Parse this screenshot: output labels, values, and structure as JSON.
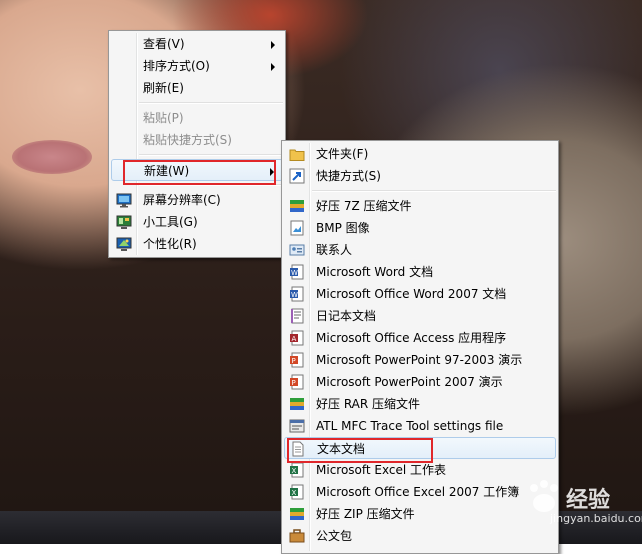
{
  "context_menu": {
    "items": [
      {
        "label": "查看(V)"
      },
      {
        "label": "排序方式(O)"
      },
      {
        "label": "刷新(E)"
      },
      {
        "label": "粘贴(P)"
      },
      {
        "label": "粘贴快捷方式(S)"
      },
      {
        "label": "新建(W)"
      },
      {
        "label": "屏幕分辨率(C)"
      },
      {
        "label": "小工具(G)"
      },
      {
        "label": "个性化(R)"
      }
    ]
  },
  "new_submenu": {
    "items": [
      {
        "label": "文件夹(F)",
        "icon": "folder-icon"
      },
      {
        "label": "快捷方式(S)",
        "icon": "shortcut-icon"
      },
      {
        "label": "好压 7Z 压缩文件",
        "icon": "archive-icon"
      },
      {
        "label": "BMP 图像",
        "icon": "image-icon"
      },
      {
        "label": "联系人",
        "icon": "contact-icon"
      },
      {
        "label": "Microsoft Word 文档",
        "icon": "word-icon"
      },
      {
        "label": "Microsoft Office Word 2007 文档",
        "icon": "word-icon"
      },
      {
        "label": "日记本文档",
        "icon": "journal-icon"
      },
      {
        "label": "Microsoft Office Access 应用程序",
        "icon": "access-icon"
      },
      {
        "label": "Microsoft PowerPoint 97-2003 演示",
        "icon": "powerpoint-icon"
      },
      {
        "label": "Microsoft PowerPoint 2007 演示",
        "icon": "powerpoint-icon"
      },
      {
        "label": "好压 RAR 压缩文件",
        "icon": "archive-icon"
      },
      {
        "label": "ATL MFC Trace Tool settings file",
        "icon": "settings-file-icon"
      },
      {
        "label": "文本文档",
        "icon": "text-document-icon"
      },
      {
        "label": "Microsoft Excel 工作表",
        "icon": "excel-icon"
      },
      {
        "label": "Microsoft Office Excel 2007 工作簿",
        "icon": "excel-icon"
      },
      {
        "label": "好压 ZIP 压缩文件",
        "icon": "archive-icon"
      },
      {
        "label": "公文包",
        "icon": "briefcase-icon"
      }
    ]
  },
  "watermark": {
    "title": "经验",
    "url": "jingyan.baidu.com"
  },
  "colors": {
    "highlight": "#e0272b",
    "menu_bg": "#f5f5f5",
    "hover_border": "#aeccea"
  }
}
